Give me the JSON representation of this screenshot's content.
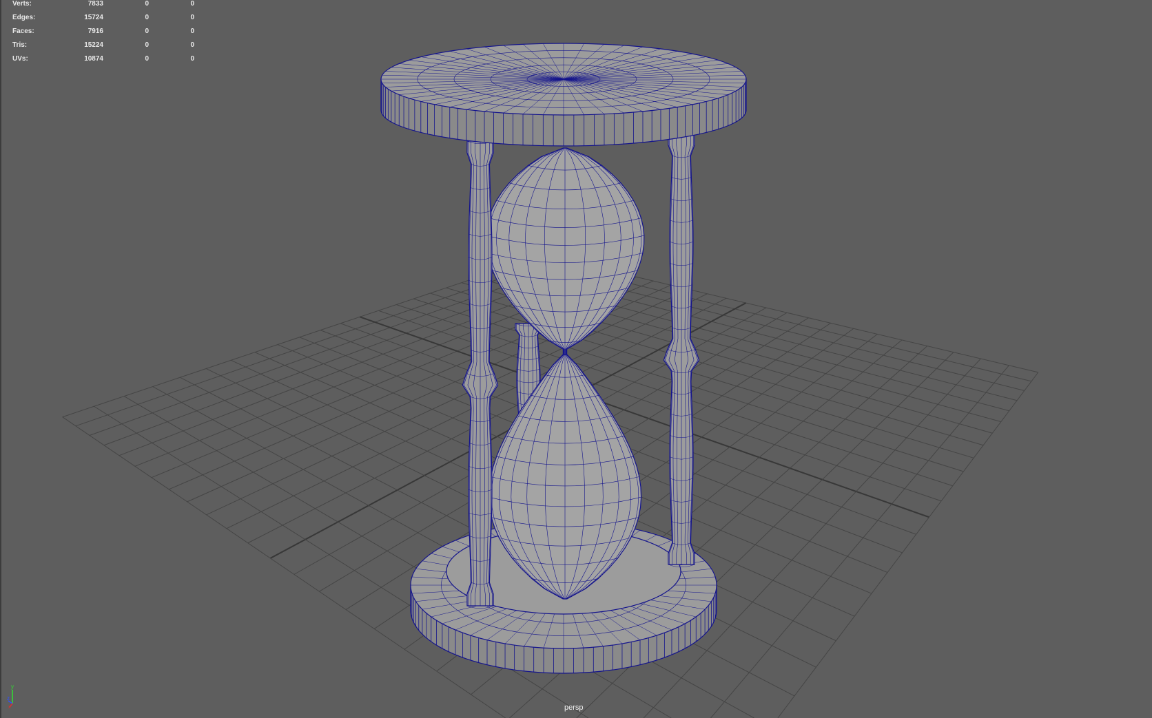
{
  "hud": {
    "rows": [
      {
        "label": "Verts:",
        "values": [
          "7833",
          "0",
          "0"
        ]
      },
      {
        "label": "Edges:",
        "values": [
          "15724",
          "0",
          "0"
        ]
      },
      {
        "label": "Faces:",
        "values": [
          "7916",
          "0",
          "0"
        ]
      },
      {
        "label": "Tris:",
        "values": [
          "15224",
          "0",
          "0"
        ]
      },
      {
        "label": "UVs:",
        "values": [
          "10874",
          "0",
          "0"
        ]
      }
    ]
  },
  "camera_label": "persp",
  "axis_labels": {
    "x": "x",
    "y": "y",
    "z": "z"
  },
  "colors": {
    "background": "#5e5e5e",
    "grid": "#454545",
    "wire": "#14148c",
    "surface": "#9c9c9c"
  }
}
